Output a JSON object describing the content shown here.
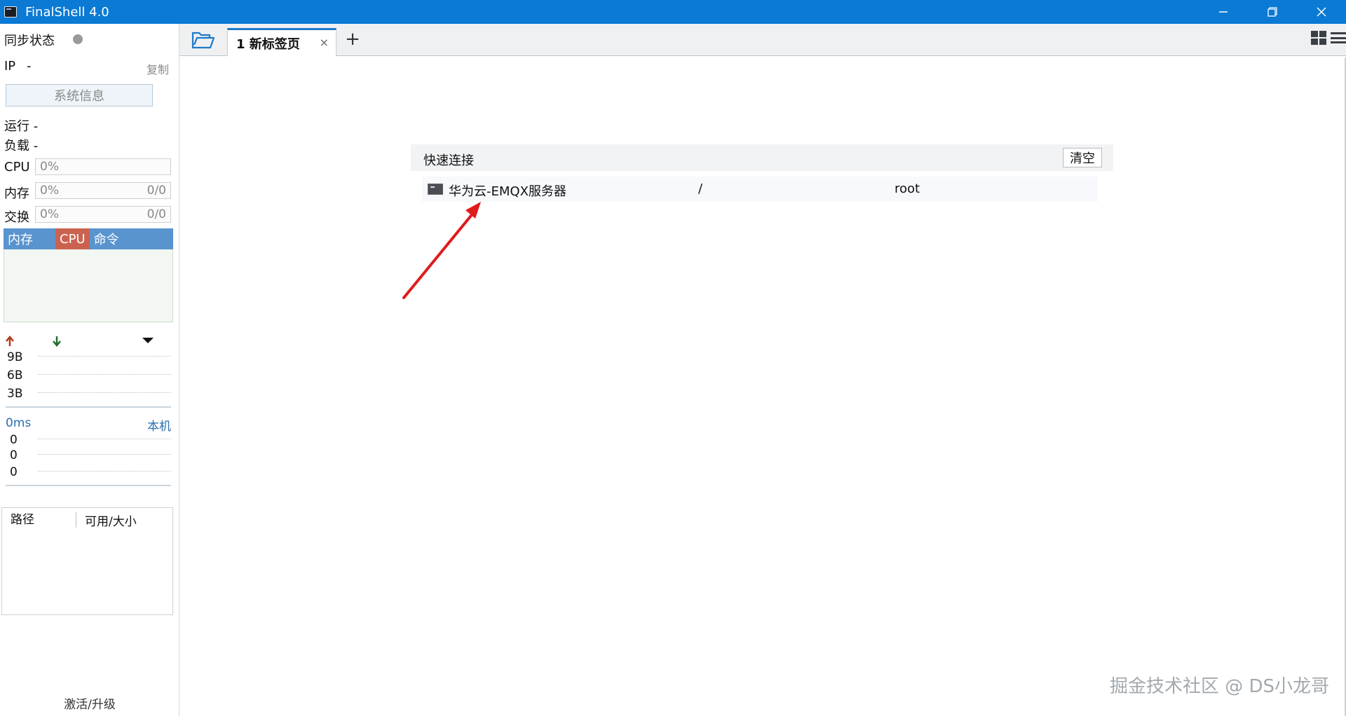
{
  "window": {
    "title": "FinalShell 4.0"
  },
  "sidebar": {
    "sync_label": "同步状态",
    "ip_label": "IP",
    "ip_value": "-",
    "copy_label": "复制",
    "sysinfo_label": "系统信息",
    "run_label": "运行 -",
    "load_label": "负载 -",
    "cpu": {
      "label": "CPU",
      "percent": "0%"
    },
    "mem": {
      "label": "内存",
      "percent": "0%",
      "ratio": "0/0"
    },
    "swap": {
      "label": "交换",
      "percent": "0%",
      "ratio": "0/0"
    },
    "tabs": [
      "内存",
      "CPU",
      "命令"
    ],
    "net_axis": [
      "9B",
      "6B",
      "3B"
    ],
    "latency": "0ms",
    "host": "本机",
    "ping_axis": [
      "0",
      "0",
      "0"
    ],
    "fs_columns": [
      "路径",
      "可用/大小"
    ],
    "activate_label": "激活/升级"
  },
  "tabbar": {
    "tab_label": "1 新标签页",
    "close_symbol": "×",
    "add_symbol": "+"
  },
  "quick_connect": {
    "title": "快速连接",
    "clear_label": "清空",
    "items": [
      {
        "name": "华为云-EMQX服务器",
        "path": "/",
        "user": "root"
      }
    ]
  },
  "watermark": "掘金技术社区 @ DS小龙哥",
  "colors": {
    "titlebar": "#0a7ad4",
    "tab_accent": "#1e78c8",
    "cpu_tab": "#cb6250",
    "mini_tabs": "#5a94cf",
    "annotation_arrow": "#e01b1b"
  }
}
